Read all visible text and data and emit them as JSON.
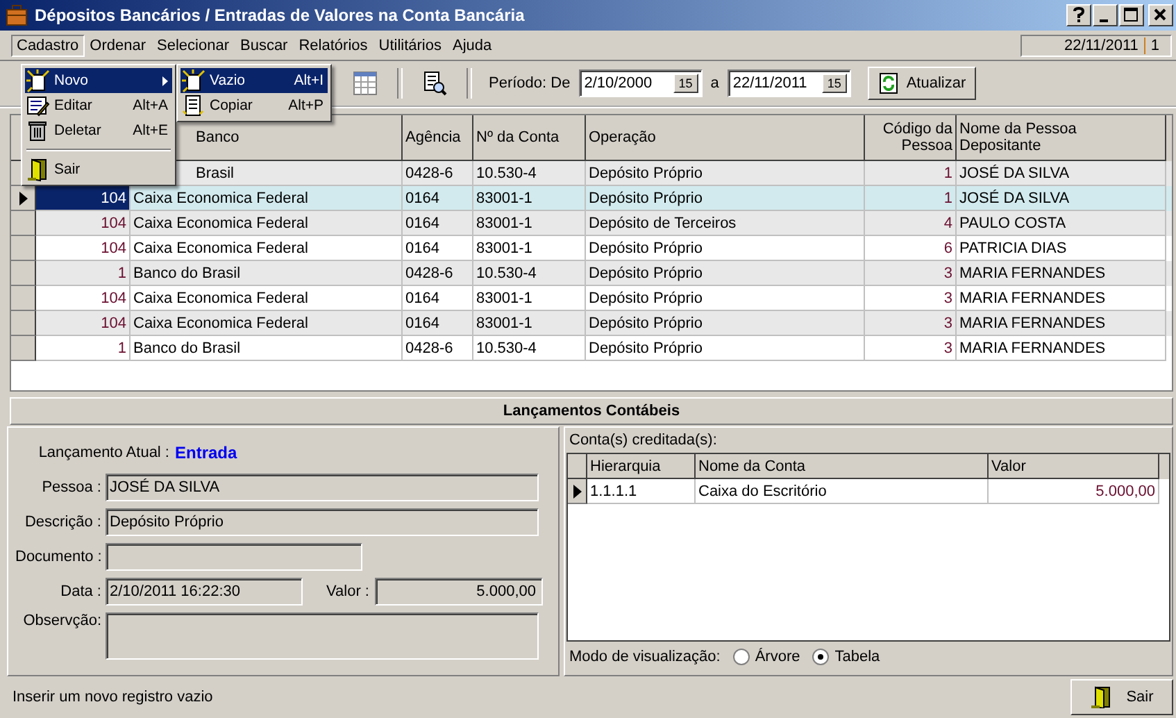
{
  "window": {
    "title": "Dépositos Bancários / Entradas de Valores na Conta Bancária"
  },
  "menu_bar": {
    "items": [
      {
        "label": "Cadastro",
        "selected": true
      },
      {
        "label": "Ordenar",
        "selected": false
      },
      {
        "label": "Selecionar",
        "selected": false
      },
      {
        "label": "Buscar",
        "selected": false
      },
      {
        "label": "Relatórios",
        "selected": false
      },
      {
        "label": "Utilitários",
        "selected": false
      },
      {
        "label": "Ajuda",
        "selected": false
      }
    ],
    "date": "22/11/2011",
    "session": "1"
  },
  "open_menu": {
    "items": [
      {
        "kind": "item",
        "label": "Novo",
        "submenu": true,
        "selected": true
      },
      {
        "kind": "item",
        "label": "Editar",
        "shortcut": "Alt+A",
        "selected": false
      },
      {
        "kind": "item",
        "label": "Deletar",
        "shortcut": "Alt+E",
        "selected": false
      },
      {
        "kind": "separator"
      },
      {
        "kind": "item",
        "label": "Sair",
        "selected": false
      }
    ],
    "submenu": [
      {
        "label": "Vazio",
        "shortcut": "Alt+I",
        "selected": true
      },
      {
        "label": "Copiar",
        "shortcut": "Alt+P",
        "selected": false
      }
    ]
  },
  "toolbar": {
    "period_label": "Período: De",
    "from": "2/10/2000",
    "from_calendar": "15",
    "to_label": "a",
    "to": "22/11/2011",
    "to_calendar": "15",
    "refresh_button": "Atualizar"
  },
  "table": {
    "columns": [
      "Banco",
      "Agência",
      "Nº da Conta",
      "Operação",
      "Código da Pessoa",
      "Nome da Pessoa Depositante"
    ],
    "rows": [
      {
        "selected": false,
        "bank": "Brasil",
        "agency": "0428-6",
        "account": "10.530-4",
        "operation": "Depósito Próprio",
        "person_code": "1",
        "person_name": "JOSÉ DA SILVA"
      },
      {
        "selected": true,
        "code": "104",
        "bank": "Caixa Economica Federal",
        "agency": "0164",
        "account": "83001-1",
        "operation": "Depósito Próprio",
        "person_code": "1",
        "person_name": "JOSÉ DA SILVA"
      },
      {
        "selected": false,
        "code": "104",
        "bank": "Caixa Economica Federal",
        "agency": "0164",
        "account": "83001-1",
        "operation": "Depósito de Terceiros",
        "person_code": "4",
        "person_name": "PAULO COSTA"
      },
      {
        "selected": false,
        "code": "104",
        "bank": "Caixa Economica Federal",
        "agency": "0164",
        "account": "83001-1",
        "operation": "Depósito Próprio",
        "person_code": "6",
        "person_name": "PATRICIA DIAS"
      },
      {
        "selected": false,
        "code": "1",
        "bank": "Banco do Brasil",
        "agency": "0428-6",
        "account": "10.530-4",
        "operation": "Depósito Próprio",
        "person_code": "3",
        "person_name": "MARIA FERNANDES"
      },
      {
        "selected": false,
        "code": "104",
        "bank": "Caixa Economica Federal",
        "agency": "0164",
        "account": "83001-1",
        "operation": "Depósito Próprio",
        "person_code": "3",
        "person_name": "MARIA FERNANDES"
      },
      {
        "selected": false,
        "code": "104",
        "bank": "Caixa Economica Federal",
        "agency": "0164",
        "account": "83001-1",
        "operation": "Depósito Próprio",
        "person_code": "3",
        "person_name": "MARIA FERNANDES"
      },
      {
        "selected": false,
        "code": "1",
        "bank": "Banco do Brasil",
        "agency": "0428-6",
        "account": "10.530-4",
        "operation": "Depósito Próprio",
        "person_code": "3",
        "person_name": "MARIA FERNANDES"
      }
    ]
  },
  "entries": {
    "title": "Lançamentos Contábeis",
    "current_label": "Lançamento Atual :",
    "current_value": "Entrada",
    "person": {
      "label": "Pessoa :",
      "value": "JOSÉ DA SILVA"
    },
    "description": {
      "label": "Descrição :",
      "value": "Depósito Próprio"
    },
    "document": {
      "label": "Documento :"
    },
    "date": {
      "label": "Data :",
      "value": "2/10/2011 16:22:30"
    },
    "amount": {
      "label": "Valor :",
      "value": "5.000,00"
    },
    "notes": {
      "label": "Observção:"
    }
  },
  "credited": {
    "label": "Conta(s) creditada(s):",
    "columns": [
      "Hierarquia",
      "Nome da Conta",
      "Valor"
    ],
    "rows": [
      {
        "selected": true,
        "hierarchy": "1.1.1.1",
        "account": "Caixa do Escritório",
        "value": "5.000,00"
      }
    ],
    "view_mode": {
      "label": "Modo de visualização:",
      "options": [
        {
          "label": "Árvore",
          "selected": false
        },
        {
          "label": "Tabela",
          "selected": true
        }
      ]
    }
  },
  "status_bar": {
    "message": "Inserir um novo registro vazio",
    "exit_button": "Sair"
  }
}
